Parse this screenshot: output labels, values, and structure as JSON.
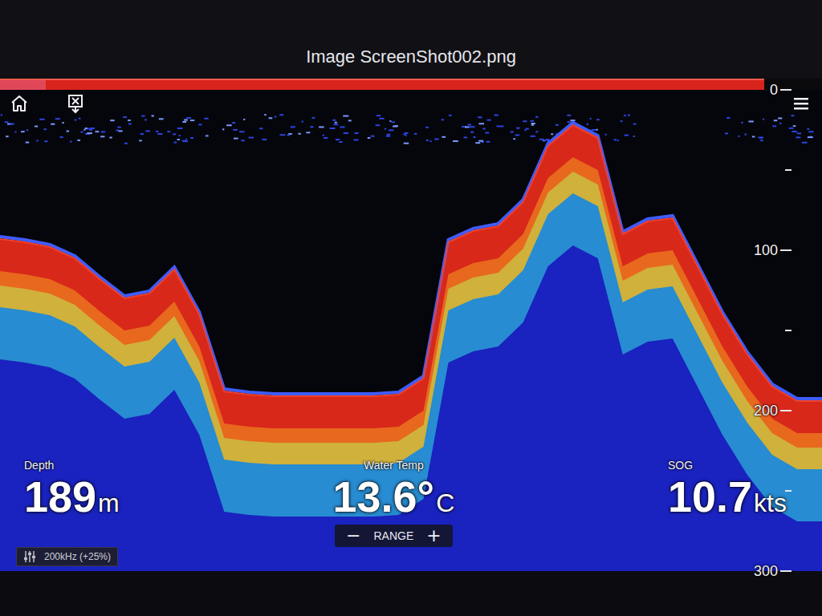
{
  "window": {
    "title": "Image ScreenShot002.png"
  },
  "depth_scale": {
    "ticks": [
      "0",
      "100",
      "200",
      "300"
    ],
    "range": [
      0,
      300
    ]
  },
  "echogram": {
    "bottom_depths": [
      93,
      95,
      98,
      105,
      118,
      130,
      127,
      112,
      140,
      188,
      190,
      191,
      191,
      191,
      191,
      191,
      190,
      180,
      95,
      88,
      85,
      70,
      35,
      22,
      30,
      90,
      82,
      80,
      110,
      140,
      165,
      185,
      194,
      194
    ]
  },
  "readouts": [
    {
      "label": "Depth",
      "value": "189",
      "unit": "m"
    },
    {
      "label": "Water Temp",
      "value": "13.6°",
      "unit": "C"
    },
    {
      "label": "SOG",
      "value": "10.7",
      "unit": "kts"
    }
  ],
  "range_control": {
    "label": "RANGE",
    "decrease": "−",
    "increase": "+"
  },
  "frequency": {
    "label": "200kHz (+25%)"
  }
}
